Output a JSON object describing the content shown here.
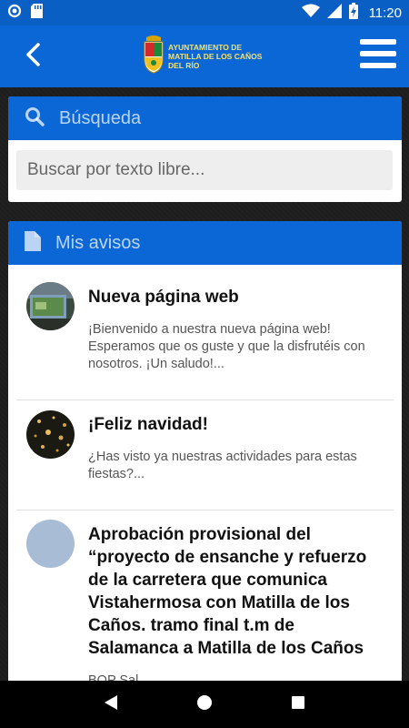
{
  "status_bar": {
    "time": "11:20",
    "icons": [
      "sync-icon",
      "sd-card-icon",
      "wifi-icon",
      "signal-icon",
      "battery-charging-icon"
    ]
  },
  "app_bar": {
    "logo_lines": [
      "Ayuntamiento de",
      "Matilla de los Caños",
      "del Río"
    ],
    "back_icon": "chevron-left-icon",
    "menu_icon": "hamburger-menu-icon"
  },
  "search": {
    "title": "Búsqueda",
    "placeholder": "Buscar por texto libre...",
    "value": ""
  },
  "avisos": {
    "title": "Mis avisos",
    "items": [
      {
        "title": "Nueva página web",
        "text": "¡Bienvenido a nuestra nueva página web! Esperamos que os guste y que la disfrutéis con nosotros. ¡Un saludo!..."
      },
      {
        "title": "¡Feliz navidad!",
        "text": "¿Has visto ya nuestras actividades para estas fiestas?..."
      },
      {
        "title": "Aprobación provisional del “proyecto de ensanche y refuerzo de la carretera que comunica Vistahermosa con Matilla de los Caños. tramo final t.m de Salamanca a Matilla de los Caños",
        "text": "BOP Sal..."
      }
    ]
  },
  "colors": {
    "primary": "#0b67d6",
    "status_bar": "#0a5fc4",
    "logo_text": "#f7e26b"
  }
}
